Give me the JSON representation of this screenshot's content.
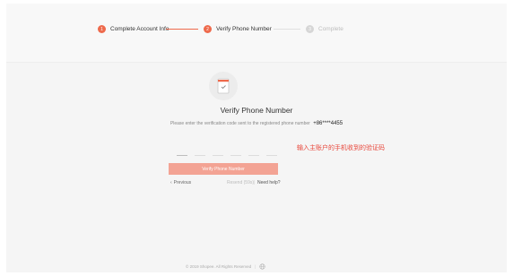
{
  "steps": [
    {
      "number": "1",
      "label": "Complete Account Info",
      "state": "done"
    },
    {
      "number": "2",
      "label": "Verify Phone Number",
      "state": "active"
    },
    {
      "number": "3",
      "label": "Complete",
      "state": "todo"
    }
  ],
  "verify": {
    "icon": "phone-check-icon",
    "title": "Verify Phone Number",
    "instruction": "Please enter the verification code sent to the registered phone number",
    "phone_number": "+86****4455",
    "code_length": 6,
    "submit_label": "Verify Phone Number"
  },
  "annotation": {
    "text": "输入主账户的手机收到的验证码",
    "color": "#e8473b"
  },
  "nav": {
    "previous_label": "Previous",
    "resend_label": "Resend (59s)",
    "separator": "|",
    "help_label": "Need help?"
  },
  "footer": {
    "copyright": "© 2019 Shopee. All Rights Reserved",
    "separator": "|",
    "language_icon": "globe-icon"
  },
  "colors": {
    "accent": "#ee6a4c",
    "button_disabled": "#f3a394",
    "background": "#f5f5f5"
  }
}
